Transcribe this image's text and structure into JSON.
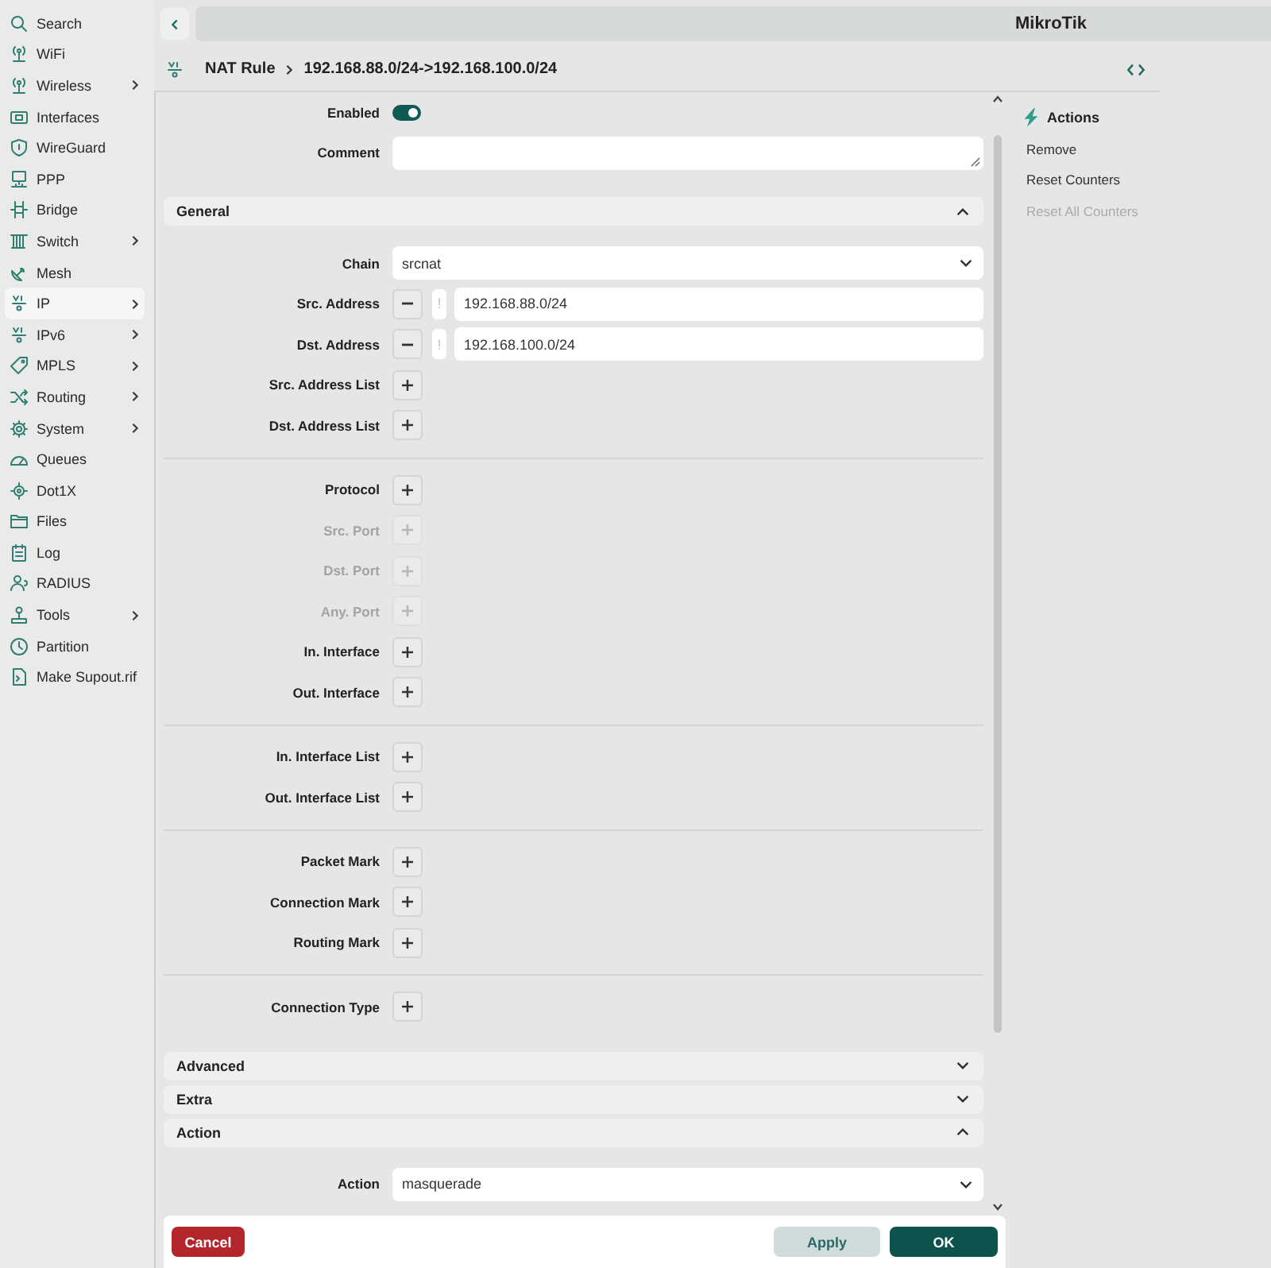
{
  "sidebar": {
    "items": [
      {
        "label": "Search",
        "submenu": false,
        "selected": false
      },
      {
        "label": "WiFi",
        "submenu": false,
        "selected": false
      },
      {
        "label": "Wireless",
        "submenu": true,
        "selected": false
      },
      {
        "label": "Interfaces",
        "submenu": false,
        "selected": false
      },
      {
        "label": "WireGuard",
        "submenu": false,
        "selected": false
      },
      {
        "label": "PPP",
        "submenu": false,
        "selected": false
      },
      {
        "label": "Bridge",
        "submenu": false,
        "selected": false
      },
      {
        "label": "Switch",
        "submenu": true,
        "selected": false
      },
      {
        "label": "Mesh",
        "submenu": false,
        "selected": false
      },
      {
        "label": "IP",
        "submenu": true,
        "selected": true
      },
      {
        "label": "IPv6",
        "submenu": true,
        "selected": false
      },
      {
        "label": "MPLS",
        "submenu": true,
        "selected": false
      },
      {
        "label": "Routing",
        "submenu": true,
        "selected": false
      },
      {
        "label": "System",
        "submenu": true,
        "selected": false
      },
      {
        "label": "Queues",
        "submenu": false,
        "selected": false
      },
      {
        "label": "Dot1X",
        "submenu": false,
        "selected": false
      },
      {
        "label": "Files",
        "submenu": false,
        "selected": false
      },
      {
        "label": "Log",
        "submenu": false,
        "selected": false
      },
      {
        "label": "RADIUS",
        "submenu": false,
        "selected": false
      },
      {
        "label": "Tools",
        "submenu": true,
        "selected": false
      },
      {
        "label": "Partition",
        "submenu": false,
        "selected": false
      },
      {
        "label": "Make Supout.rif",
        "submenu": false,
        "selected": false
      }
    ]
  },
  "header": {
    "title": "MikroTik"
  },
  "breadcrumb": {
    "section": "NAT Rule",
    "item": "192.168.88.0/24->192.168.100.0/24"
  },
  "form": {
    "top_fields": [
      {
        "kind": "toggle",
        "label": "Enabled",
        "on": true
      },
      {
        "kind": "textarea",
        "label": "Comment"
      }
    ],
    "sections": [
      {
        "title": "General",
        "expanded": true,
        "groups": [
          {
            "fields": [
              {
                "kind": "select",
                "label": "Chain",
                "value": "srcnat"
              },
              {
                "kind": "address",
                "label": "Src. Address",
                "negate": "!",
                "value": "192.168.88.0/24"
              },
              {
                "kind": "address",
                "label": "Dst. Address",
                "negate": "!",
                "value": "192.168.100.0/24"
              },
              {
                "kind": "add",
                "label": "Src. Address List",
                "disabled": false
              },
              {
                "kind": "add",
                "label": "Dst. Address List",
                "disabled": false
              }
            ]
          },
          {
            "fields": [
              {
                "kind": "add",
                "label": "Protocol",
                "disabled": false
              },
              {
                "kind": "add",
                "label": "Src. Port",
                "disabled": true
              },
              {
                "kind": "add",
                "label": "Dst. Port",
                "disabled": true
              },
              {
                "kind": "add",
                "label": "Any. Port",
                "disabled": true
              },
              {
                "kind": "add",
                "label": "In. Interface",
                "disabled": false
              },
              {
                "kind": "add",
                "label": "Out. Interface",
                "disabled": false
              }
            ]
          },
          {
            "fields": [
              {
                "kind": "add",
                "label": "In. Interface List",
                "disabled": false
              },
              {
                "kind": "add",
                "label": "Out. Interface List",
                "disabled": false
              }
            ]
          },
          {
            "fields": [
              {
                "kind": "add",
                "label": "Packet Mark",
                "disabled": false
              },
              {
                "kind": "add",
                "label": "Connection Mark",
                "disabled": false
              },
              {
                "kind": "add",
                "label": "Routing Mark",
                "disabled": false
              }
            ]
          },
          {
            "fields": [
              {
                "kind": "add",
                "label": "Connection Type",
                "disabled": false
              }
            ]
          }
        ]
      },
      {
        "title": "Advanced",
        "expanded": false
      },
      {
        "title": "Extra",
        "expanded": false
      },
      {
        "title": "Action",
        "expanded": true,
        "groups": [
          {
            "fields": [
              {
                "kind": "select",
                "label": "Action",
                "value": "masquerade"
              }
            ]
          }
        ]
      }
    ]
  },
  "footer": {
    "buttons": [
      {
        "label": "Cancel",
        "kind": "danger"
      },
      {
        "label": "Apply",
        "kind": "secondary"
      },
      {
        "label": "OK",
        "kind": "primary"
      }
    ]
  },
  "actions": {
    "title": "Actions",
    "items": [
      {
        "label": "Remove",
        "disabled": false
      },
      {
        "label": "Reset Counters",
        "disabled": false
      },
      {
        "label": "Reset All Counters",
        "disabled": true
      }
    ]
  }
}
